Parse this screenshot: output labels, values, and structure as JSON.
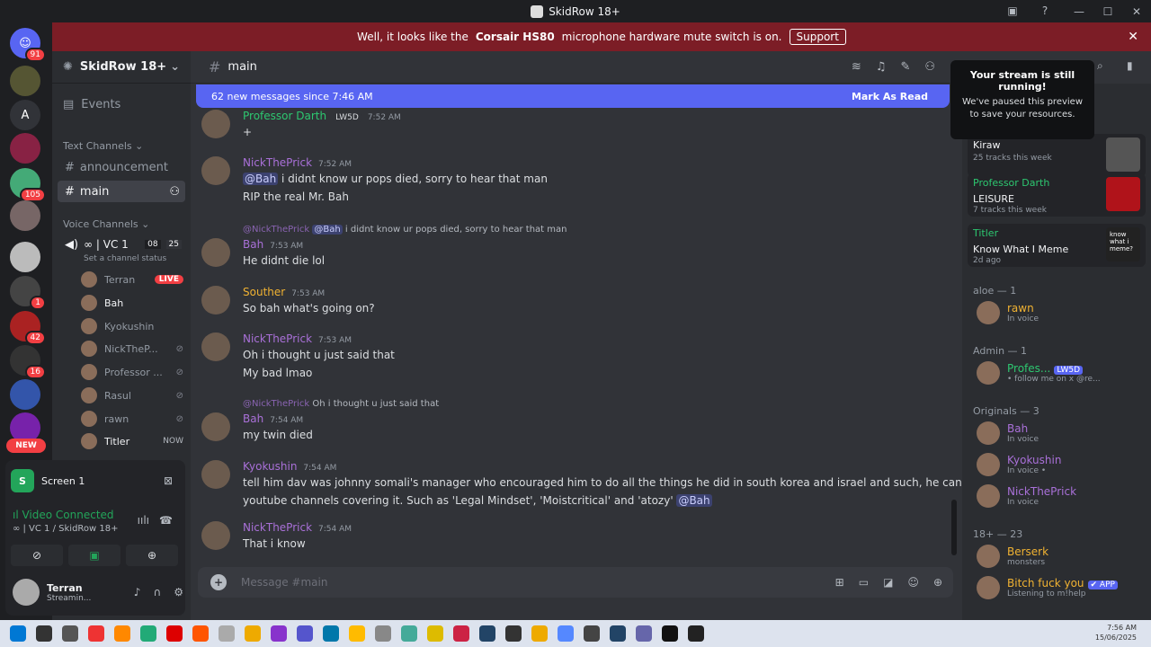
{
  "window": {
    "title": "SkidRow 18+"
  },
  "banner": {
    "text_pre": "Well, it looks like the",
    "device": "Corsair HS80",
    "text_post": "microphone hardware mute switch is on.",
    "button": "Support"
  },
  "servers": {
    "home_badge": "91",
    "a_label": "A",
    "b1": "105",
    "b2": "1",
    "b3": "42",
    "b4": "16",
    "new_label": "NEW"
  },
  "guild": {
    "name": "SkidRow 18+",
    "events": "Events",
    "text_category": "Text Channels",
    "voice_category": "Voice Channels",
    "channels": [
      "announcement",
      "main"
    ],
    "vc_name": "∞ | VC 1",
    "vc_count1": "08",
    "vc_count2": "25",
    "vc_status": "Set a channel status"
  },
  "voice_users": [
    {
      "name": "Terran",
      "extra": "LIVE"
    },
    {
      "name": "Bah",
      "extra": ""
    },
    {
      "name": "Kyokushin",
      "extra": ""
    },
    {
      "name": "NickTheP...",
      "extra": ""
    },
    {
      "name": "Professor ...",
      "extra": ""
    },
    {
      "name": "Rasul",
      "extra": ""
    },
    {
      "name": "rawn",
      "extra": ""
    },
    {
      "name": "Titler",
      "extra": "NOW"
    }
  ],
  "panel": {
    "screen": "Screen 1",
    "connected": "Video Connected",
    "vc": "∞ | VC 1 / SkidRow 18+",
    "user": "Terran",
    "user_status": "Streamin..."
  },
  "chat": {
    "channel": "main",
    "new_msgs": "62 new messages since 7:46 AM",
    "mark_read": "Mark As Read",
    "input_placeholder": "Message #main"
  },
  "messages": [
    {
      "author": "Professor Darth",
      "tag": "LW5D",
      "time": "7:52 AM",
      "color": "#2dc770",
      "lines": [
        "+"
      ]
    },
    {
      "author": "NickThePrick",
      "time": "7:52 AM",
      "color": "#a970d8",
      "mention": "@Bah",
      "lines": [
        "i didnt know ur pops died, sorry to hear that man",
        "RIP the real Mr. Bah"
      ]
    },
    {
      "reply_to": "@NickThePrick",
      "reply_mention": "@Bah",
      "reply_text": "i didnt know ur pops died, sorry to hear that man",
      "author": "Bah",
      "time": "7:53 AM",
      "color": "#a970d8",
      "lines": [
        "He didnt die lol"
      ]
    },
    {
      "author": "Souther",
      "time": "7:53 AM",
      "color": "#f0b232",
      "lines": [
        "So bah what's going on?"
      ]
    },
    {
      "author": "NickThePrick",
      "time": "7:53 AM",
      "color": "#a970d8",
      "lines": [
        "Oh i thought u just said that",
        "My bad lmao"
      ]
    },
    {
      "reply_to": "@NickThePrick",
      "reply_text": "Oh i thought u just said that",
      "author": "Bah",
      "time": "7:54 AM",
      "color": "#a970d8",
      "lines": [
        "my twin died"
      ]
    },
    {
      "author": "Kyokushin",
      "time": "7:54 AM",
      "color": "#a970d8",
      "lines": [
        "tell him dav was johnny somali's manager who encouraged him to do all the things he did in south korea and israel and such, he can find big",
        "youtube channels covering it. Such as 'Legal Mindset', 'Moistcritical' and 'atozy'"
      ],
      "mention_end": "@Bah"
    },
    {
      "author": "NickThePrick",
      "time": "7:54 AM",
      "color": "#a970d8",
      "lines": [
        "That i know"
      ]
    }
  ],
  "tooltip": {
    "title": "Your stream is still running!",
    "body": "We've paused this preview to save your resources."
  },
  "activities": [
    {
      "name": "Kiraw",
      "sub": "25 tracks this week"
    },
    {
      "user": "Professor Darth",
      "name": "LEISURE",
      "sub": "7 tracks this week"
    },
    {
      "user": "Titler",
      "name": "Know What I Meme",
      "sub": "2d ago",
      "thumb_text": "know what i meme?"
    }
  ],
  "member_groups": [
    {
      "title": "aloe — 1",
      "members": [
        {
          "name": "rawn",
          "status": "In voice",
          "color": "#f0b232"
        }
      ]
    },
    {
      "title": "Admin — 1",
      "members": [
        {
          "name": "Profes...",
          "tag": "LW5D",
          "status": "• follow me on x @re...",
          "color": "#2dc770"
        }
      ]
    },
    {
      "title": "Originals — 3",
      "members": [
        {
          "name": "Bah",
          "status": "In voice",
          "color": "#a970d8"
        },
        {
          "name": "Kyokushin",
          "status": "In voice • ",
          "color": "#a970d8"
        },
        {
          "name": "NickThePrick",
          "status": "In voice",
          "color": "#a970d8"
        }
      ]
    },
    {
      "title": "18+ — 23",
      "members": [
        {
          "name": "Berserk",
          "status": "monsters",
          "color": "#f0b232"
        },
        {
          "name": "Bitch fuck you",
          "tag": "✔ APP",
          "status": "Listening to m!help",
          "color": "#f0b232"
        }
      ]
    }
  ],
  "clock": {
    "time": "7:56 AM",
    "date": "15/06/2025"
  }
}
